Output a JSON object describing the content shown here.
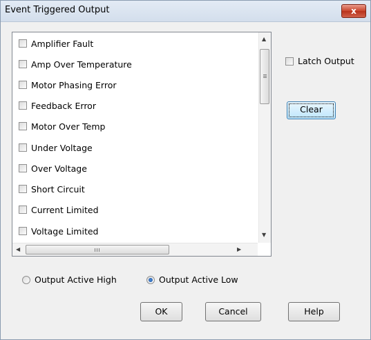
{
  "window": {
    "title": "Event Triggered Output",
    "close_label": "x"
  },
  "events": [
    {
      "label": "Amplifier Fault",
      "checked": false
    },
    {
      "label": "Amp Over Temperature",
      "checked": false
    },
    {
      "label": "Motor Phasing Error",
      "checked": false
    },
    {
      "label": "Feedback Error",
      "checked": false
    },
    {
      "label": "Motor Over Temp",
      "checked": false
    },
    {
      "label": "Under Voltage",
      "checked": false
    },
    {
      "label": "Over Voltage",
      "checked": false
    },
    {
      "label": "Short Circuit",
      "checked": false
    },
    {
      "label": "Current Limited",
      "checked": false
    },
    {
      "label": "Voltage Limited",
      "checked": false
    }
  ],
  "latch": {
    "label": "Latch Output",
    "checked": false
  },
  "buttons": {
    "clear": "Clear",
    "ok": "OK",
    "cancel": "Cancel",
    "help": "Help"
  },
  "output_mode": {
    "options": [
      "Output Active High",
      "Output Active Low"
    ],
    "selected": "Output Active Low"
  },
  "scrollbar_glyphs": {
    "up": "▲",
    "down": "▼",
    "left": "◀",
    "right": "▶",
    "hgrip": "III"
  }
}
